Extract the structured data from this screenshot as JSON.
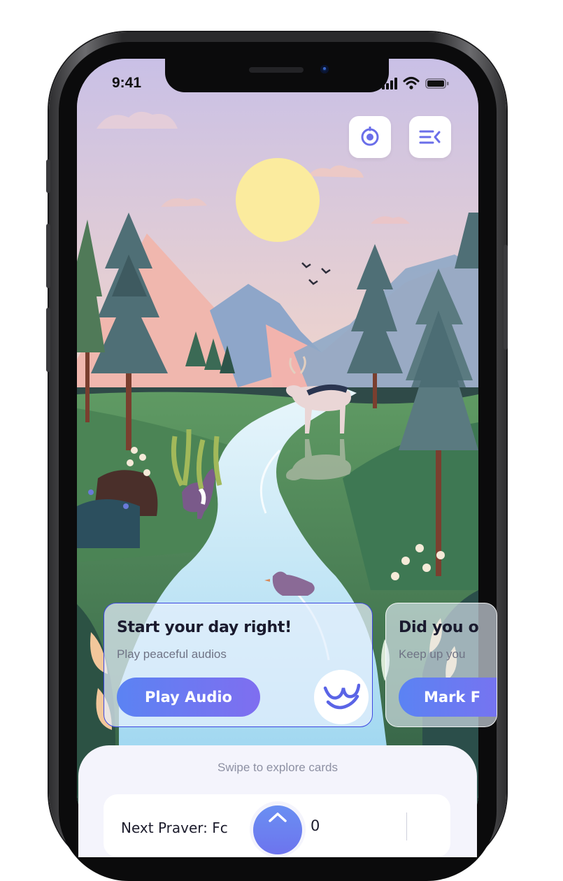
{
  "status_bar": {
    "time": "9:41",
    "icons": [
      "signal-icon",
      "wifi-icon",
      "battery-icon"
    ]
  },
  "top_buttons": {
    "left_icon": "target-icon",
    "right_icon": "menu-collapse-icon"
  },
  "cards": [
    {
      "title": "Start your day right!",
      "subtitle": "Play peaceful audios",
      "button_label": "Play Audio",
      "icon": "wave-logo-icon"
    },
    {
      "title": "Did you o",
      "subtitle": "Keep up you",
      "button_label": "Mark F"
    }
  ],
  "bottom_sheet": {
    "hint": "Swipe to explore cards",
    "next_prayer_label": "Next Praver: Fc",
    "next_prayer_time": "0"
  },
  "colors": {
    "accent_gradient_start": "#5b83f3",
    "accent_gradient_end": "#7f6ef0",
    "card_border_active": "#3d47e0",
    "sheet_background": "#f4f4fc"
  }
}
